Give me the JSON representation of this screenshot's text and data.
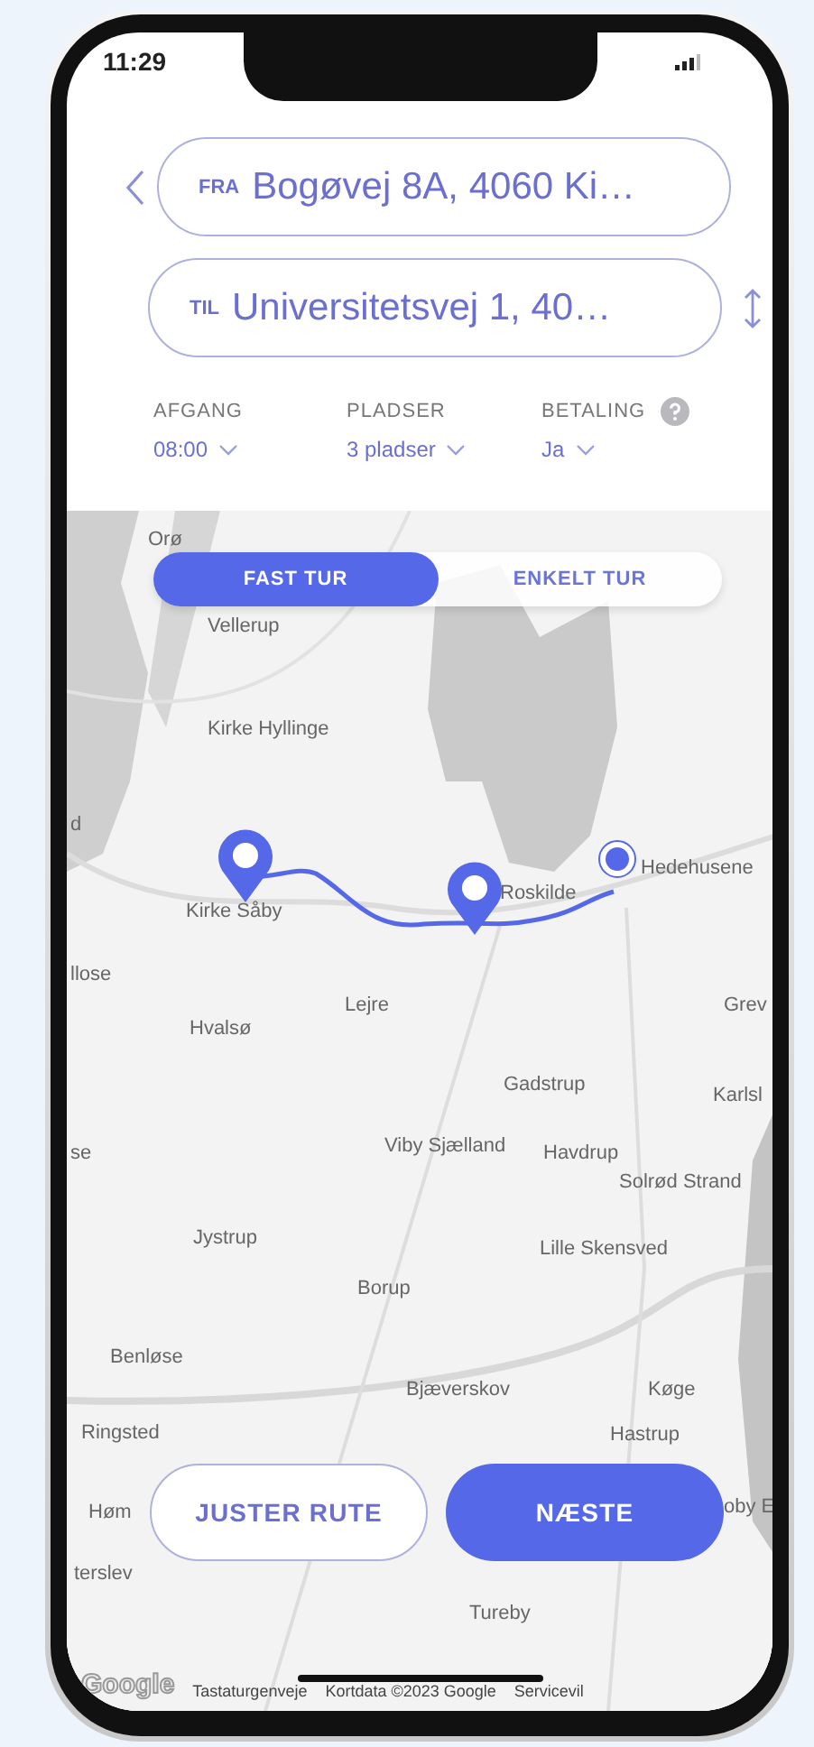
{
  "status_bar": {
    "time": "11:29"
  },
  "route": {
    "from": {
      "label": "FRA",
      "value": "Bogøvej 8A, 4060 Ki…"
    },
    "to": {
      "label": "TIL",
      "value": "Universitetsvej 1, 40…"
    }
  },
  "options": [
    {
      "label": "AFGANG",
      "value": "08:00",
      "help": false
    },
    {
      "label": "PLADSER",
      "value": "3 pladser",
      "help": false
    },
    {
      "label": "BETALING",
      "value": "Ja",
      "help": true
    }
  ],
  "trip_types": [
    {
      "label": "FAST TUR",
      "selected": true
    },
    {
      "label": "ENKELT TUR",
      "selected": false
    }
  ],
  "map": {
    "labels": [
      "Orø",
      "Vellerup",
      "Kirke Hyllinge",
      "d",
      "Kirke Såby",
      "Roskilde",
      "Hedehusene",
      "llose",
      "Hvalsø",
      "Lejre",
      "Grev",
      "Gadstrup",
      "Karlsl",
      "se",
      "Viby Sjælland",
      "Havdrup",
      "Solrød Strand",
      "Jystrup",
      "Lille Skensved",
      "Borup",
      "Benløse",
      "Bjæverskov",
      "Køge",
      "Ringsted",
      "Hastrup",
      "Høm",
      "oby E",
      "terslev",
      "Tureby"
    ]
  },
  "buttons": [
    {
      "label": "JUSTER RUTE",
      "kind": "outline"
    },
    {
      "label": "NÆSTE",
      "kind": "primary"
    }
  ],
  "attribution": {
    "logo": "Google",
    "links": [
      "Tastaturgenveje",
      "Kortdata ©2023 Google",
      "Servicevil"
    ]
  }
}
